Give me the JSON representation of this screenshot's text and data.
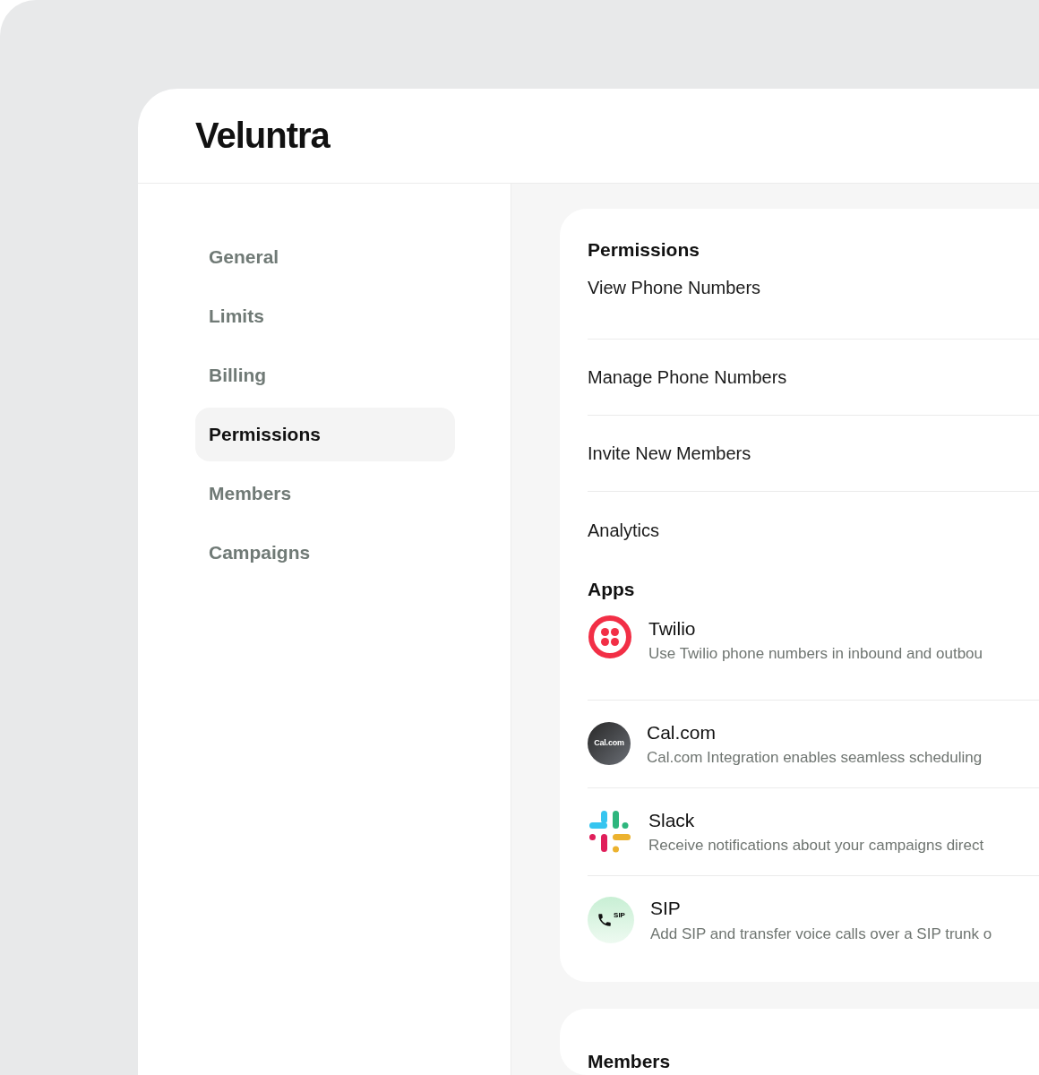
{
  "app_title": "Veluntra",
  "sidebar": {
    "items": [
      {
        "label": "General",
        "selected": false
      },
      {
        "label": "Limits",
        "selected": false
      },
      {
        "label": "Billing",
        "selected": false
      },
      {
        "label": "Permissions",
        "selected": true
      },
      {
        "label": "Members",
        "selected": false
      },
      {
        "label": "Campaigns",
        "selected": false
      }
    ]
  },
  "permissions": {
    "title": "Permissions",
    "items": [
      "View Phone Numbers",
      "Manage Phone Numbers",
      "Invite New Members",
      "Analytics"
    ]
  },
  "apps": {
    "title": "Apps",
    "items": [
      {
        "kind": "twilio",
        "name": "Twilio",
        "description": "Use Twilio phone numbers in inbound and outbou"
      },
      {
        "kind": "calcom",
        "name": "Cal.com",
        "logo_text": "Cal.com",
        "description": "Cal.com Integration enables seamless scheduling"
      },
      {
        "kind": "slack",
        "name": "Slack",
        "description": "Receive notifications about your campaigns direct"
      },
      {
        "kind": "sip",
        "name": "SIP",
        "logo_text": "SIP",
        "description": "Add SIP and transfer voice calls over a SIP trunk o"
      }
    ]
  },
  "members": {
    "title": "Members"
  }
}
